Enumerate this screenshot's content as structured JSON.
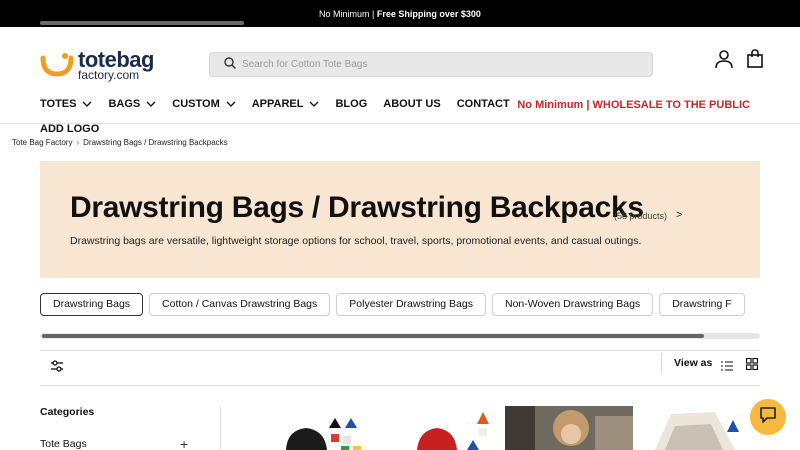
{
  "announcement": {
    "text_plain": "No Minimum | ",
    "text_bold": "Free Shipping over $300"
  },
  "brand": {
    "name_main": "totebag",
    "name_sub": "factory.com",
    "accent": "#f39c1f",
    "navy": "#1c2b4a"
  },
  "search": {
    "placeholder": "Search for Cotton Tote Bags"
  },
  "header_icons": [
    "user-icon",
    "bag-icon"
  ],
  "nav": {
    "items": [
      {
        "label": "TOTES",
        "has_dropdown": true
      },
      {
        "label": "BAGS",
        "has_dropdown": true
      },
      {
        "label": "CUSTOM",
        "has_dropdown": true
      },
      {
        "label": "APPAREL",
        "has_dropdown": true
      },
      {
        "label": "BLOG",
        "has_dropdown": false
      },
      {
        "label": "ABOUT US",
        "has_dropdown": false
      },
      {
        "label": "CONTACT",
        "has_dropdown": false
      }
    ],
    "add_logo": "ADD LOGO",
    "promo": "No Minimum | WHOLESALE TO THE PUBLIC",
    "promo_color": "#c0282d"
  },
  "breadcrumb": {
    "home": "Tote Bag Factory",
    "current": "Drawstring Bags / Drawstring Backpacks"
  },
  "hero": {
    "title": "Drawstring Bags / Drawstring Backpacks",
    "count": "(58 products)",
    "arrow": ">",
    "description": "Drawstring bags are versatile, lightweight storage options for school, travel, sports, promotional events, and casual outings.",
    "bg": "#f9e6d2"
  },
  "subcategories": [
    {
      "label": "Drawstring Bags",
      "active": true
    },
    {
      "label": "Cotton / Canvas Drawstring Bags",
      "active": false
    },
    {
      "label": "Polyester Drawstring Bags",
      "active": false
    },
    {
      "label": "Non-Woven Drawstring Bags",
      "active": false
    },
    {
      "label": "Drawstring F",
      "active": false
    }
  ],
  "toolbar": {
    "view_as": "View as"
  },
  "sidebar": {
    "heading": "Categories",
    "categories": [
      {
        "label": "Tote Bags",
        "expand": "+"
      }
    ]
  },
  "chat": {
    "color": "#f6b840"
  }
}
